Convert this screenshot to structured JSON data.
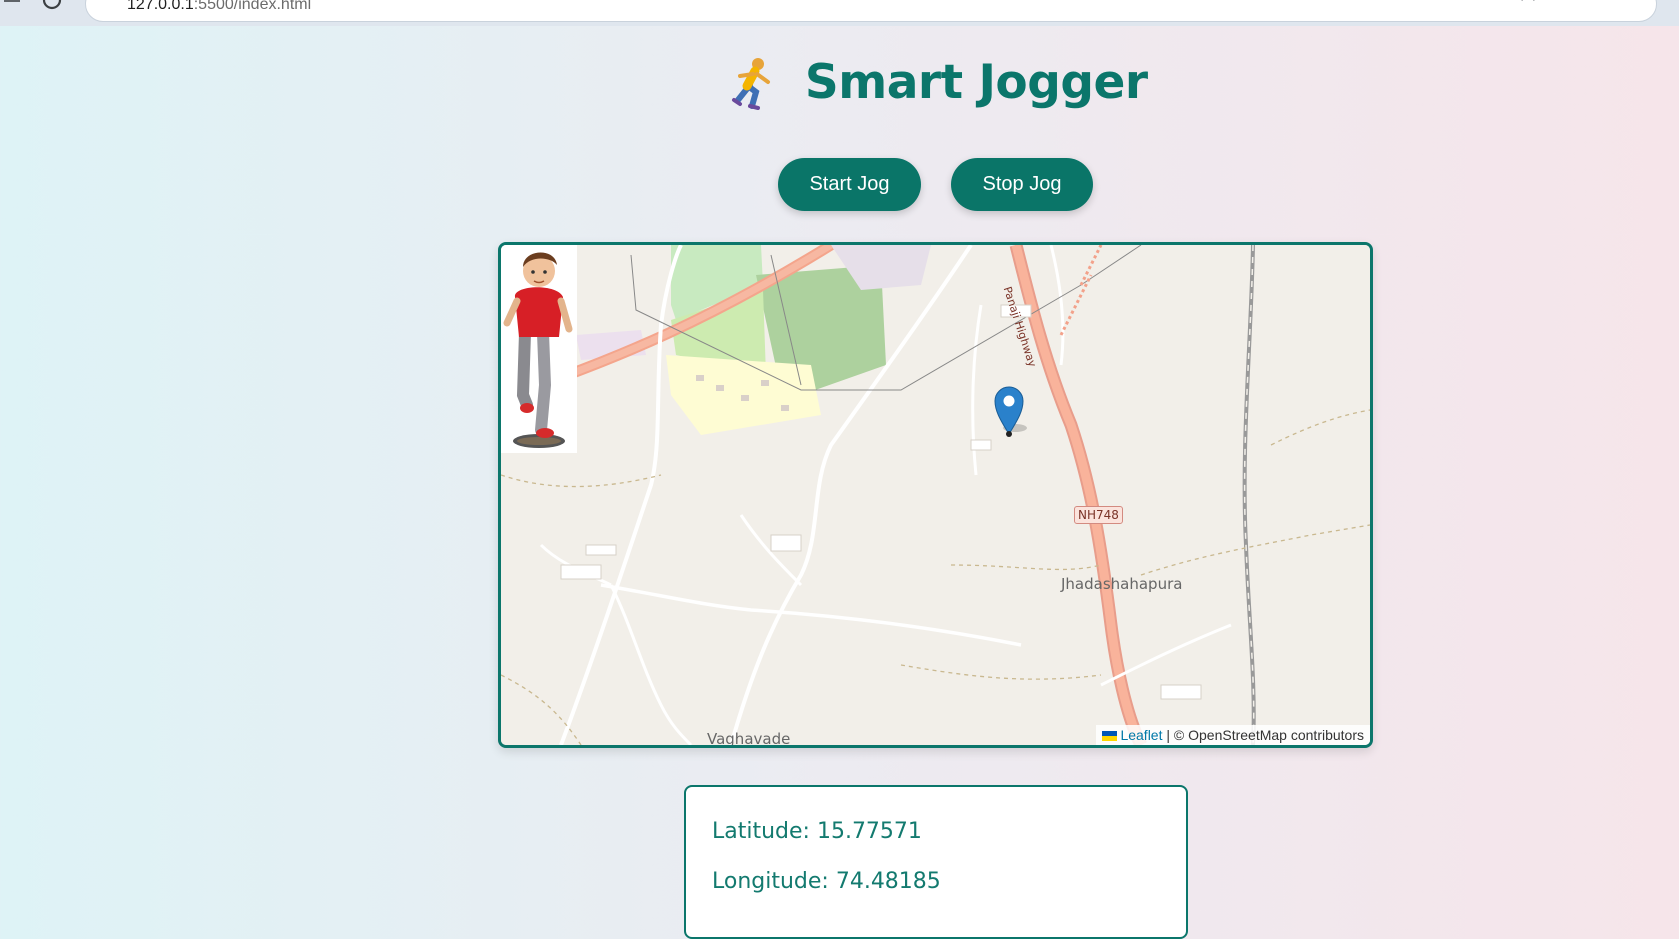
{
  "browser": {
    "url_host": "127.0.0.1",
    "url_path": ":5500/index.html"
  },
  "header": {
    "title": "Smart Jogger",
    "runner_icon": "person-running-icon"
  },
  "controls": {
    "start_label": "Start Jog",
    "stop_label": "Stop Jog"
  },
  "map": {
    "labels": {
      "town": "Jhadashahapura",
      "village": "Vaghavade",
      "highway_shield": "NH748",
      "highway_name": "Panaji Highway"
    },
    "attribution": {
      "link": "Leaflet",
      "separator": " | ",
      "text": "© OpenStreetMap contributors"
    },
    "marker_icon": "map-pin-icon",
    "avatar_icon": "jogger-character-icon"
  },
  "location": {
    "latitude_label": "Latitude: 15.77571",
    "longitude_label": "Longitude: 74.48185"
  },
  "colors": {
    "accent": "#0b766b",
    "button_bg": "#0a7568",
    "marker": "#2a81cb"
  }
}
